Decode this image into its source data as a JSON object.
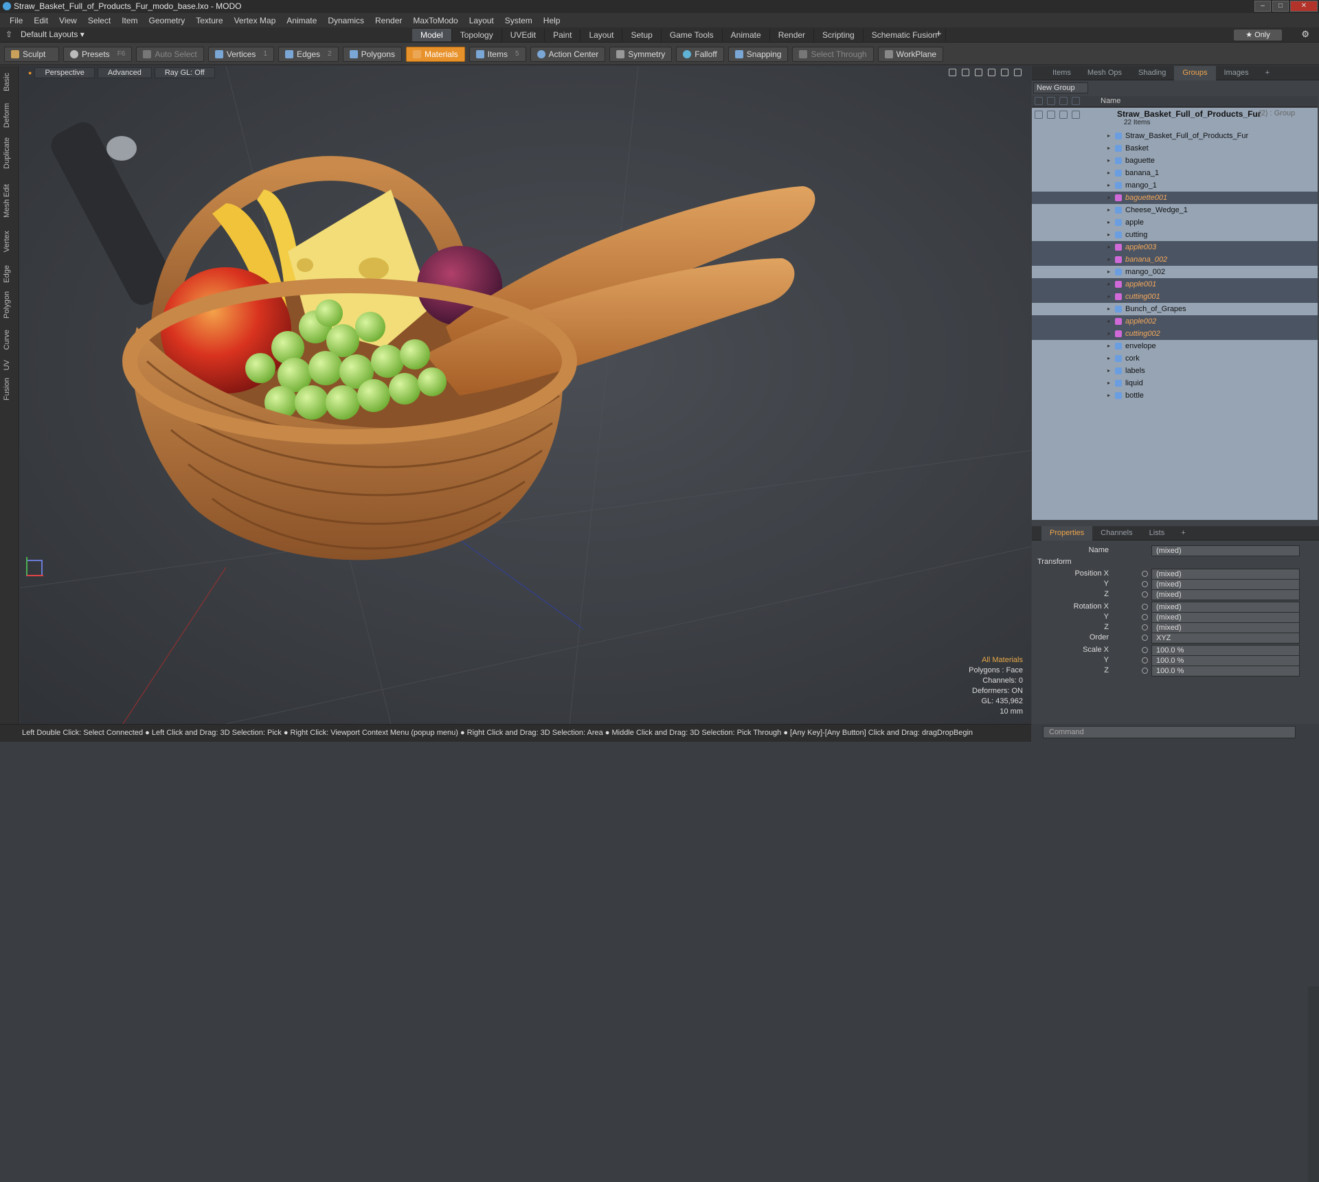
{
  "window": {
    "title": "Straw_Basket_Full_of_Products_Fur_modo_base.lxo - MODO"
  },
  "menu": [
    "File",
    "Edit",
    "View",
    "Select",
    "Item",
    "Geometry",
    "Texture",
    "Vertex Map",
    "Animate",
    "Dynamics",
    "Render",
    "MaxToModo",
    "Layout",
    "System",
    "Help"
  ],
  "layouts_label": "Default Layouts ▾",
  "mode_tabs": [
    "Model",
    "Topology",
    "UVEdit",
    "Paint",
    "Layout",
    "Setup",
    "Game Tools",
    "Animate",
    "Render",
    "Scripting",
    "Schematic Fusion"
  ],
  "only_label": "★ Only",
  "toolbar": {
    "sculpt": "Sculpt",
    "presets": "Presets",
    "presets_key": "F6",
    "auto_select": "Auto Select",
    "vertices": "Vertices",
    "vertices_key": "1",
    "edges": "Edges",
    "edges_key": "2",
    "polygons": "Polygons",
    "materials": "Materials",
    "items": "Items",
    "items_key": "5",
    "action_center": "Action Center",
    "symmetry": "Symmetry",
    "falloff": "Falloff",
    "snapping": "Snapping",
    "select_through": "Select Through",
    "workplane": "WorkPlane"
  },
  "left_tabs": [
    "Basic",
    "Deform",
    "Duplicate",
    "Mesh Edit",
    "Vertex",
    "Edge",
    "Polygon",
    "Curve",
    "UV",
    "Fusion"
  ],
  "viewport": {
    "perspective": "Perspective",
    "advanced": "Advanced",
    "raygl": "Ray GL: Off",
    "info": {
      "all_materials": "All Materials",
      "polygons": "Polygons : Face",
      "channels": "Channels: 0",
      "deformers": "Deformers: ON",
      "gl": "GL: 435,962",
      "unit": "10 mm"
    }
  },
  "status": "Left Double Click: Select Connected ● Left Click and Drag: 3D Selection: Pick ● Right Click: Viewport Context Menu (popup menu) ● Right Click and Drag: 3D Selection: Area ● Middle Click and Drag: 3D Selection: Pick Through ● [Any Key]-[Any Button] Click and Drag: dragDropBegin",
  "panel_tabs": [
    "Items",
    "Mesh Ops",
    "Shading",
    "Groups",
    "Images",
    "+"
  ],
  "groups": {
    "new_group": "New Group",
    "name_header": "Name",
    "group_name": "Straw_Basket_Full_of_Products_Fur",
    "group_type": "(2) : Group",
    "group_count": "22 Items",
    "items": [
      {
        "label": "Straw_Basket_Full_of_Products_Fur",
        "sel": false
      },
      {
        "label": "Basket",
        "sel": false
      },
      {
        "label": "baguette",
        "sel": false
      },
      {
        "label": "banana_1",
        "sel": false
      },
      {
        "label": "mango_1",
        "sel": false
      },
      {
        "label": "baguette001",
        "sel": true
      },
      {
        "label": "Cheese_Wedge_1",
        "sel": false
      },
      {
        "label": "apple",
        "sel": false
      },
      {
        "label": "cutting",
        "sel": false
      },
      {
        "label": "apple003",
        "sel": true
      },
      {
        "label": "banana_002",
        "sel": true
      },
      {
        "label": "mango_002",
        "sel": false
      },
      {
        "label": "apple001",
        "sel": true
      },
      {
        "label": "cutting001",
        "sel": true
      },
      {
        "label": "Bunch_of_Grapes",
        "sel": false
      },
      {
        "label": "apple002",
        "sel": true
      },
      {
        "label": "cutting002",
        "sel": true
      },
      {
        "label": "envelope",
        "sel": false
      },
      {
        "label": "cork",
        "sel": false
      },
      {
        "label": "labels",
        "sel": false
      },
      {
        "label": "liquid",
        "sel": false
      },
      {
        "label": "bottle",
        "sel": false
      }
    ]
  },
  "props_tabs": [
    "Properties",
    "Channels",
    "Lists",
    "+"
  ],
  "properties": {
    "name_label": "Name",
    "name_value": "(mixed)",
    "transform": "Transform",
    "position_x": "Position X",
    "y": "Y",
    "z": "Z",
    "rotation_x": "Rotation X",
    "order": "Order",
    "order_value": "XYZ",
    "scale_x": "Scale X",
    "mixed": "(mixed)",
    "scale_value": "100.0 %"
  },
  "command_placeholder": "Command",
  "colors": {
    "accent": "#e8922c",
    "list_bg": "#96a4b4",
    "selected_row": "#4b5463"
  }
}
